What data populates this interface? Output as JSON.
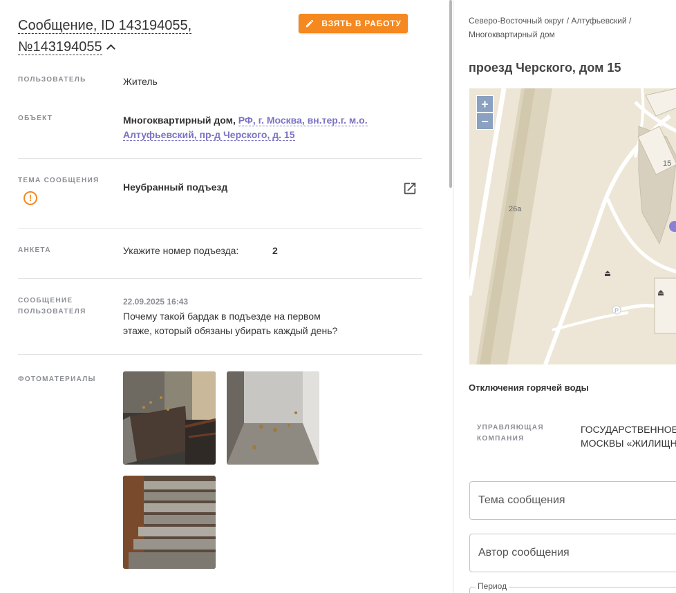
{
  "message": {
    "title_line1": "Сообщение, ID 143194055,",
    "title_line2": "№143194055",
    "take_button": "ВЗЯТЬ В РАБОТУ"
  },
  "fields": {
    "user_label": "ПОЛЬЗОВАТЕЛЬ",
    "user_value": "Житель",
    "object_label": "ОБЪЕКТ",
    "object_type": "Многоквартирный дом,",
    "object_addr_line1": "РФ, г. Москва, вн.тер.г. м.о.",
    "object_addr_line2": "Алтуфьевский, пр-д Черского, д. 15",
    "topic_label": "ТЕМА СООБЩЕНИЯ",
    "topic_value": "Неубранный подъезд",
    "form_label": "АНКЕТА",
    "form_question": "Укажите номер подъезда:",
    "form_answer": "2",
    "user_msg_label_line1": "СООБЩЕНИЕ",
    "user_msg_label_line2": "ПОЛЬЗОВАТЕЛЯ",
    "user_msg_date": "22.09.2025 16:43",
    "user_msg_line1": "Почему такой бардак в подъезде на первом",
    "user_msg_line2": "этаже, который обязаны убирать каждый день?",
    "photos_label": "ФОТОМАТЕРИАЛЫ"
  },
  "sidebar": {
    "breadcrumb_line1": "Северо-Восточный округ / Алтуфьевский /",
    "breadcrumb_line2": "Многоквартирный дом",
    "address": "проезд Черского, дом 15",
    "map": {
      "zoom_in": "+",
      "zoom_out": "−",
      "label_building_15": "15",
      "label_building_26a": "26а",
      "label_parking": "P"
    },
    "hot_water_title": "Отключения горячей воды",
    "company_label_line1": "УПРАВЛЯЮЩАЯ",
    "company_label_line2": "КОМПАНИЯ",
    "company_value_line1": "ГОСУДАРСТВЕННОЕ Б",
    "company_value_line2": "МОСКВЫ «ЖИЛИЩНИ",
    "topic_field_placeholder": "Тема сообщения",
    "author_field_placeholder": "Автор сообщения",
    "period_label": "Период"
  },
  "colors": {
    "accent_orange": "#f5881f",
    "link_purple": "#7b72c4",
    "label_gray": "#8a8d94",
    "map_zoom_blue": "#8aa1c1"
  },
  "icons": [
    "pencil-icon",
    "chevron-up-icon",
    "warning-icon",
    "external-link-icon"
  ]
}
